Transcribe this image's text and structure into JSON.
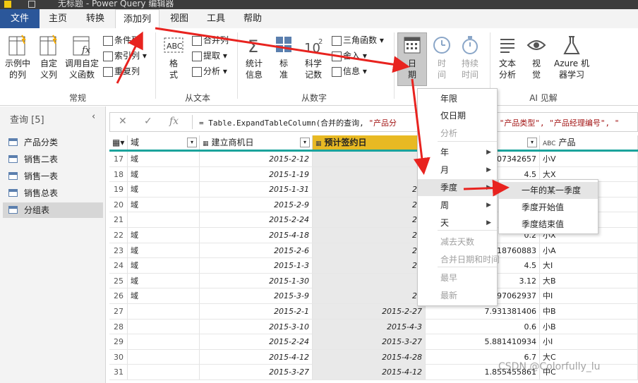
{
  "window": {
    "title": "无标题 - Power Query 编辑器"
  },
  "tabs": [
    {
      "label": "文件"
    },
    {
      "label": "主页"
    },
    {
      "label": "转换"
    },
    {
      "label": "添加列"
    },
    {
      "label": "视图"
    },
    {
      "label": "工具"
    },
    {
      "label": "帮助"
    }
  ],
  "ribbon": {
    "general": {
      "column_from_examples": "示例中\n的列",
      "custom_column": "自定\n义列",
      "invoke_function": "调用自定\n义函数",
      "conditional_column": "条件列",
      "index_column": "索引列",
      "duplicate_column": "重复列",
      "label": "常规"
    },
    "from_text": {
      "format": "格\n式",
      "merge_columns": "合并列",
      "extract": "提取",
      "parse": "分析",
      "label": "从文本"
    },
    "from_number": {
      "statistics": "统计\n信息",
      "standard": "标\n准",
      "scientific": "科学\n记数",
      "trigonometry": "三角函数",
      "rounding": "舍入",
      "information": "信息",
      "label": "从数字"
    },
    "from_datetime": {
      "date": "日\n期",
      "time": "时\n间",
      "duration": "持续\n时间"
    },
    "ai": {
      "text_analytics": "文本\n分析",
      "vision": "视\n觉",
      "azure_ml": "Azure 机\n器学习",
      "label": "AI 见解"
    }
  },
  "queries": {
    "header": "查询 [5]",
    "items": [
      {
        "label": "产品分类"
      },
      {
        "label": "销售二表"
      },
      {
        "label": "销售一表"
      },
      {
        "label": "销售总表"
      },
      {
        "label": "分组表"
      }
    ]
  },
  "formula": {
    "prefix": "= Table.ExpandTableColumn(合并的查询, ",
    "s1": "\"产品分",
    "mid": "                  ",
    "s2": "l\", \"产品类型\", \"产品经理编号\", \""
  },
  "grid": {
    "headers": [
      {
        "tag": "",
        "label": "域"
      },
      {
        "tag": "",
        "label": "建立商机日"
      },
      {
        "tag": "",
        "label": "预计签约日"
      },
      {
        "tag": "",
        "label": ""
      },
      {
        "tag": "ABC",
        "label": "产品"
      }
    ],
    "rows": [
      {
        "n": "17",
        "c1": "域",
        "c2": "2015-2-12",
        "c3": "2",
        "c4": "007342657",
        "c5": "小V"
      },
      {
        "n": "18",
        "c1": "域",
        "c2": "2015-1-19",
        "c3": "2",
        "c4": "4.5",
        "c5": "大X"
      },
      {
        "n": "19",
        "c1": "域",
        "c2": "2015-1-31",
        "c3": "20",
        "c4": "",
        "c5": ""
      },
      {
        "n": "20",
        "c1": "域",
        "c2": "2015-2-9",
        "c3": "20",
        "c4": "",
        "c5": ""
      },
      {
        "n": "21",
        "c1": "",
        "c2": "2015-2-24",
        "c3": "20",
        "c4": "",
        "c5": ""
      },
      {
        "n": "22",
        "c1": "域",
        "c2": "2015-4-18",
        "c3": "20",
        "c4": "0.2",
        "c5": "小X"
      },
      {
        "n": "23",
        "c1": "域",
        "c2": "2015-2-6",
        "c3": "20",
        "c4": "618760883",
        "c5": "小A"
      },
      {
        "n": "24",
        "c1": "域",
        "c2": "2015-1-3",
        "c3": "20",
        "c4": "4.5",
        "c5": "大I"
      },
      {
        "n": "25",
        "c1": "域",
        "c2": "2015-1-30",
        "c3": "2",
        "c4": "3.12",
        "c5": "大B"
      },
      {
        "n": "26",
        "c1": "域",
        "c2": "2015-3-9",
        "c3": "20",
        "c4": "797062937",
        "c5": "中I"
      },
      {
        "n": "27",
        "c1": "",
        "c2": "2015-2-1",
        "c3": "2015-2-27",
        "c4": "7.931381406",
        "c5": "中B"
      },
      {
        "n": "28",
        "c1": "",
        "c2": "2015-3-10",
        "c3": "2015-4-3",
        "c4": "0.6",
        "c5": "小B"
      },
      {
        "n": "29",
        "c1": "",
        "c2": "2015-2-24",
        "c3": "2015-3-27",
        "c4": "5.881410934",
        "c5": "小I"
      },
      {
        "n": "30",
        "c1": "",
        "c2": "2015-4-12",
        "c3": "2015-4-28",
        "c4": "6.7",
        "c5": "大C"
      },
      {
        "n": "31",
        "c1": "",
        "c2": "2015-3-27",
        "c3": "2015-4-12",
        "c4": "1.855455861",
        "c5": "中C"
      }
    ]
  },
  "date_menu": {
    "items": [
      {
        "label": "年限",
        "disabled": false,
        "submenu": false
      },
      {
        "label": "仅日期",
        "disabled": false,
        "submenu": false
      },
      {
        "label": "分析",
        "disabled": true,
        "submenu": false
      },
      {
        "label": "年",
        "disabled": false,
        "submenu": true
      },
      {
        "label": "月",
        "disabled": false,
        "submenu": true
      },
      {
        "label": "季度",
        "disabled": false,
        "submenu": true
      },
      {
        "label": "周",
        "disabled": false,
        "submenu": true
      },
      {
        "label": "天",
        "disabled": false,
        "submenu": true
      },
      {
        "label": "减去天数",
        "disabled": true,
        "submenu": false
      },
      {
        "label": "合并日期和时间",
        "disabled": true,
        "submenu": false
      },
      {
        "label": "最早",
        "disabled": true,
        "submenu": false
      },
      {
        "label": "最新",
        "disabled": true,
        "submenu": false
      }
    ]
  },
  "quarter_menu": {
    "items": [
      {
        "label": "一年的某一季度"
      },
      {
        "label": "季度开始值"
      },
      {
        "label": "季度结束值"
      }
    ]
  },
  "watermark": "CSDN @Colorfully_lu",
  "colors": {
    "file_tab": "#2b579a",
    "header_accent": "#1ba39c",
    "selected_column": "#e8b923",
    "annotation": "#e8231f"
  }
}
